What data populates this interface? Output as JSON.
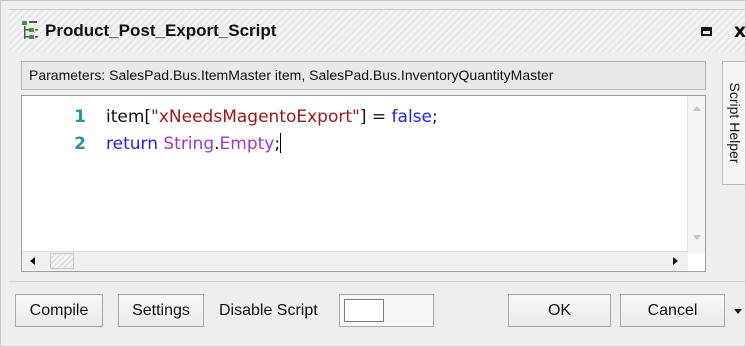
{
  "window": {
    "title": "Product_Post_Export_Script",
    "title_icon": "script-tree-icon",
    "maximize_icon": "maximize-icon",
    "close_label": "x"
  },
  "params": {
    "text": "Parameters: SalesPad.Bus.ItemMaster item, SalesPad.Bus.InventoryQuantityMaster"
  },
  "editor": {
    "lines": [
      {
        "number": "1",
        "code": "item[\"xNeedsMagentoExport\"] = false;"
      },
      {
        "number": "2",
        "code": "return String.Empty;"
      }
    ],
    "tokens": {
      "l1_a": "item[",
      "l1_str": "\"xNeedsMagentoExport\"",
      "l1_b": "] = ",
      "l1_kw": "false",
      "l1_c": ";",
      "l2_kw": "return",
      "l2_sp": " ",
      "l2_t1": "String",
      "l2_dot": ".",
      "l2_t2": "Empty",
      "l2_end": ";"
    }
  },
  "side_tab": {
    "label": "Script Helper"
  },
  "toolbar": {
    "compile_label": "Compile",
    "settings_label": "Settings",
    "disable_script_label": "Disable Script",
    "disable_script_on": false,
    "ok_label": "OK",
    "cancel_label": "Cancel",
    "more_icon": "chevron-down-icon"
  },
  "colors": {
    "line_number": "#2b91af",
    "string": "#a31515",
    "keyword": "#1f1fff",
    "type": "#a335d0"
  }
}
